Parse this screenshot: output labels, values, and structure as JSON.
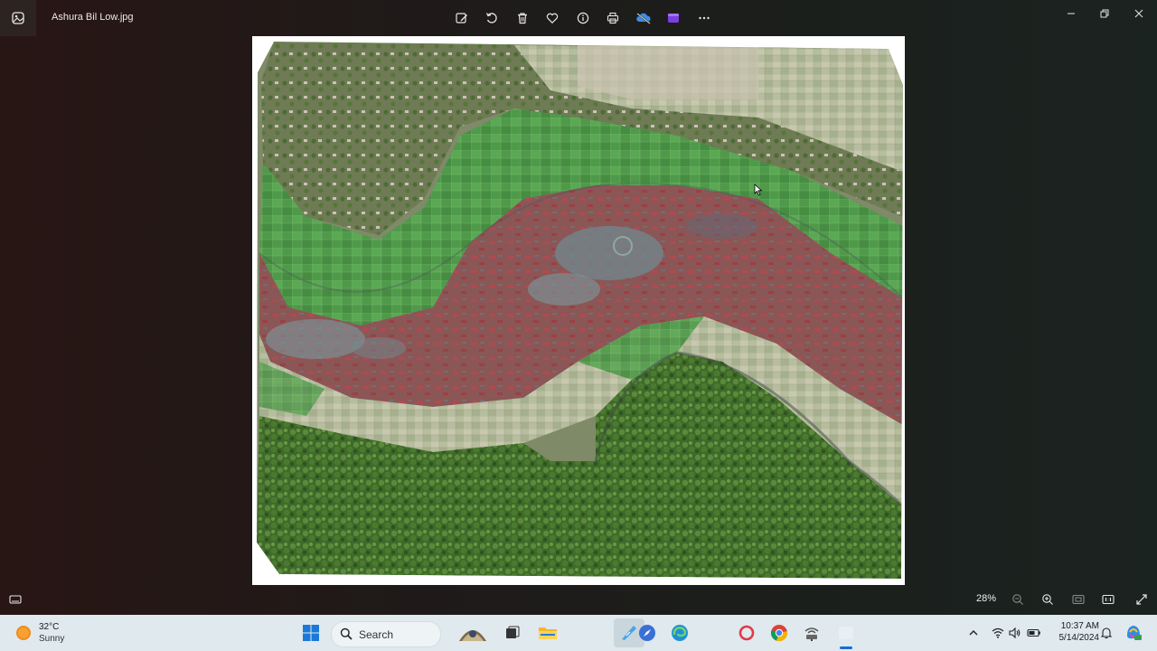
{
  "window": {
    "title": "Ashura Bil Low.jpg",
    "app_icon": "photos-app-icon"
  },
  "toolbar": {
    "buttons": [
      "edit-image-icon",
      "rotate-icon",
      "delete-icon",
      "favorite-icon",
      "info-icon",
      "print-icon",
      "onedrive-icon",
      "clipchamp-icon",
      "more-options-icon"
    ]
  },
  "window_controls": [
    "minimize-icon",
    "restore-icon",
    "close-icon"
  ],
  "image": {
    "description_icon": "aerial-orthomosaic-photo"
  },
  "statusbar": {
    "zoom": "28%"
  },
  "taskbar": {
    "weather_temp": "32°C",
    "weather_condition": "Sunny",
    "search_label": "Search",
    "time": "10:37 AM",
    "date": "5/14/2024"
  },
  "colors": {
    "accent": "#1a6bd6",
    "taskbar_bg": "#dfe9ee"
  }
}
